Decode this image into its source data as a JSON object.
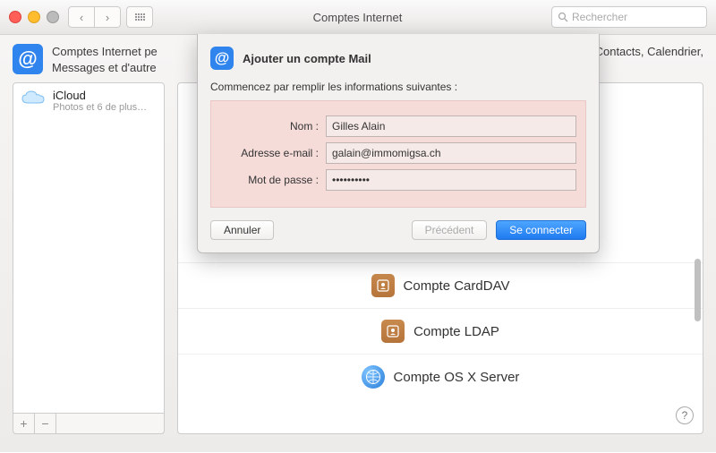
{
  "window": {
    "title": "Comptes Internet",
    "search_placeholder": "Rechercher"
  },
  "header": {
    "line1": "Comptes Internet pe",
    "line2": "Messages et d'autre",
    "right_text": "Contacts, Calendrier,"
  },
  "sidebar": {
    "account": {
      "name": "iCloud",
      "subtitle": "Photos et 6 de plus…"
    },
    "add_label": "+",
    "remove_label": "−"
  },
  "providers": {
    "carddav": "Compte CardDAV",
    "ldap": "Compte LDAP",
    "osxserver": "Compte OS X Server"
  },
  "help_label": "?",
  "sheet": {
    "title": "Ajouter un compte Mail",
    "subtitle": "Commencez par remplir les informations suivantes :",
    "fields": {
      "name_label": "Nom :",
      "name_value": "Gilles Alain",
      "email_label": "Adresse e-mail :",
      "email_value": "galain@immomigsa.ch",
      "password_label": "Mot de passe :",
      "password_value": "••••••••••"
    },
    "buttons": {
      "cancel": "Annuler",
      "previous": "Précédent",
      "signin": "Se connecter"
    }
  }
}
